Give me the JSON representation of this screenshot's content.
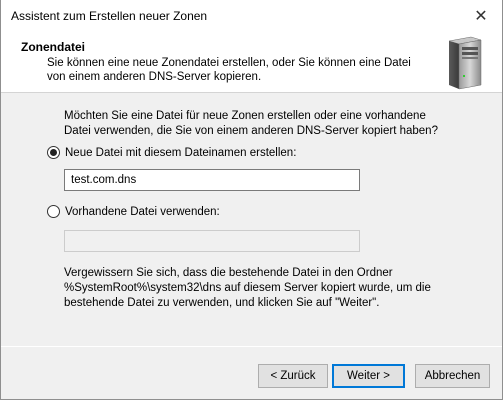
{
  "window": {
    "title": "Assistent zum Erstellen neuer Zonen",
    "close_glyph": "✕"
  },
  "header": {
    "title": "Zonendatei",
    "subtitle": "Sie können eine neue Zonendatei erstellen, oder Sie können eine Datei von einem anderen DNS-Server kopieren.",
    "icon": "server-icon"
  },
  "content": {
    "question": "Möchten Sie eine Datei für neue Zonen erstellen oder eine vorhandene Datei verwenden, die Sie von einem anderen DNS-Server kopiert haben?",
    "option_new": {
      "label": "Neue Datei mit diesem Dateinamen erstellen:",
      "checked": true,
      "value": "test.com.dns"
    },
    "option_existing": {
      "label": "Vorhandene Datei verwenden:",
      "checked": false,
      "value": ""
    },
    "note": "Vergewissern Sie sich, dass die bestehende Datei in den Ordner %SystemRoot%\\system32\\dns auf diesem Server kopiert wurde, um die bestehende Datei zu verwenden, und klicken Sie auf \"Weiter\"."
  },
  "buttons": {
    "back": "< Zurück",
    "next": "Weiter >",
    "cancel": "Abbrechen"
  },
  "colors": {
    "accent": "#0078d7",
    "background": "#f0f0f0"
  }
}
